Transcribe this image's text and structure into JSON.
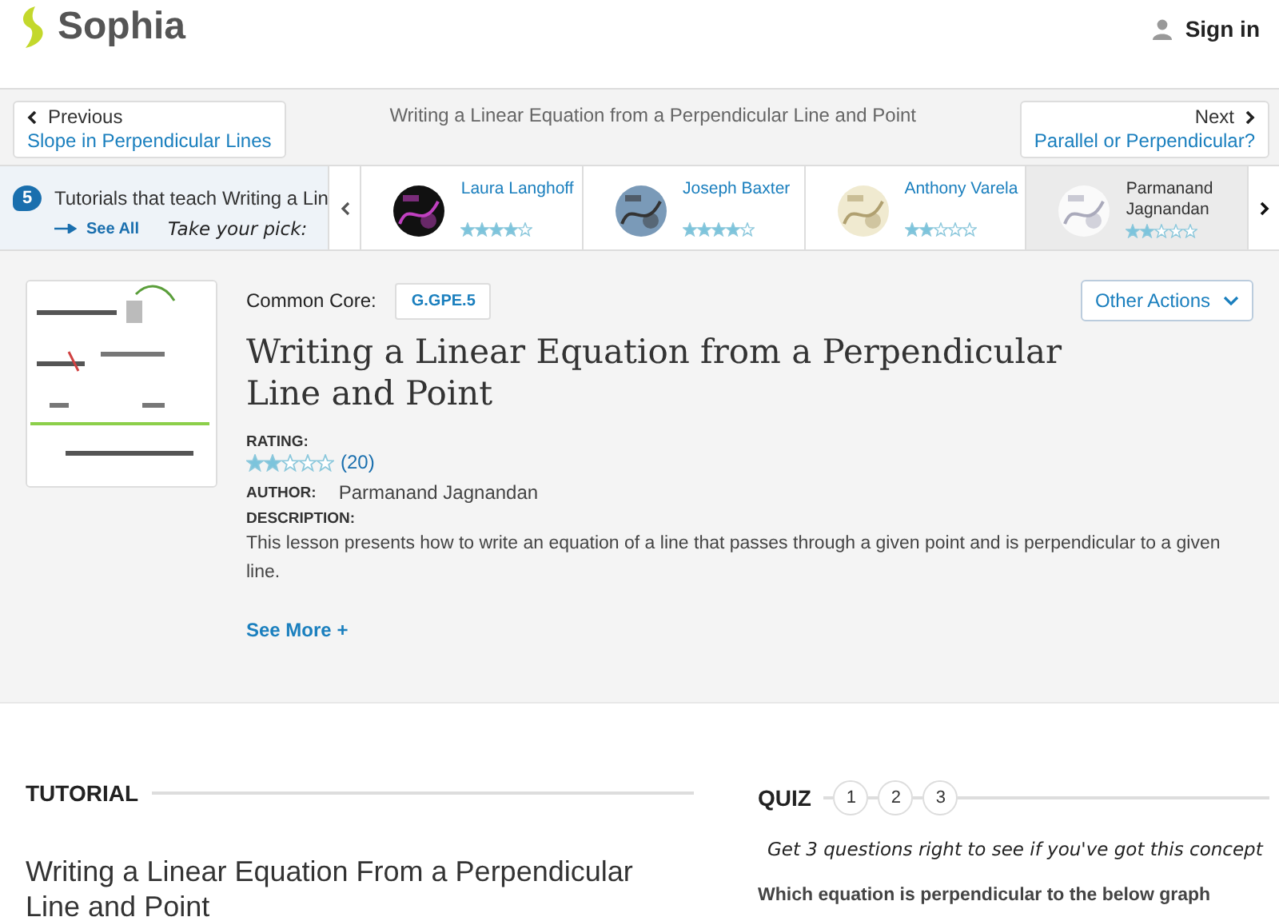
{
  "header": {
    "logo": "Sophia",
    "sign_in": "Sign in"
  },
  "nav": {
    "previous_label": "Previous",
    "previous_title": "Slope in Perpendicular Lines",
    "current_title": "Writing a Linear Equation from a Perpendicular Line and Point",
    "next_label": "Next",
    "next_title": "Parallel or Perpendicular?"
  },
  "tutorials": {
    "count": "5",
    "text": "Tutorials that teach Writing a Lin",
    "see_all": "See All",
    "pick": "Take your pick:",
    "tutors": [
      {
        "name": "Laura Langhoff",
        "stars": 4,
        "selected": false
      },
      {
        "name": "Joseph Baxter",
        "stars": 4,
        "selected": false
      },
      {
        "name": "Anthony Varela",
        "stars": 2,
        "selected": false
      },
      {
        "name": "Parmanand Jagnandan",
        "stars": 2,
        "selected": true
      }
    ]
  },
  "lesson": {
    "common_core_label": "Common Core:",
    "standard": "G.GPE.5",
    "other_actions": "Other Actions",
    "title": "Writing a Linear Equation from a Perpendicular Line and Point",
    "rating_label": "RATING:",
    "stars": 2,
    "rating_count": "(20)",
    "author_label": "AUTHOR:",
    "author": "Parmanand Jagnandan",
    "description_label": "DESCRIPTION:",
    "description": "This lesson presents how to write an equation of a line that passes through a given point and is perpendicular to a given line.",
    "see_more": "See More +"
  },
  "tutorial_section": {
    "heading": "TUTORIAL",
    "title": "Writing a Linear Equation From a Perpendicular Line and Point"
  },
  "quiz": {
    "heading": "QUIZ",
    "steps": [
      "1",
      "2",
      "3"
    ],
    "tagline": "Get 3 questions right to see if you've got this concept",
    "question": "Which equation is perpendicular to the below graph"
  }
}
